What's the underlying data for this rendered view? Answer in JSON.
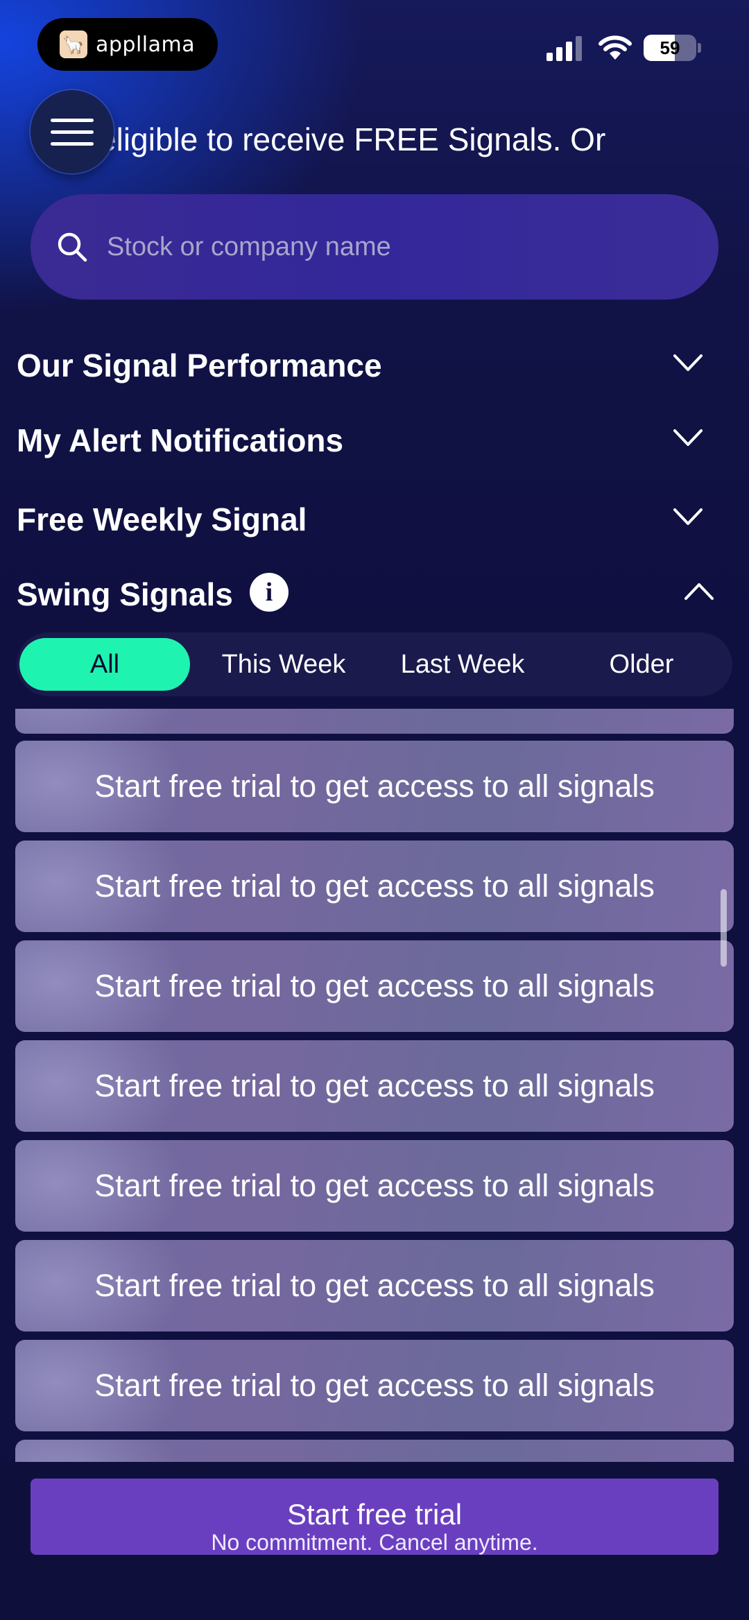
{
  "status_bar": {
    "app_name": "appllama",
    "battery_level": 59,
    "battery_text": "59"
  },
  "header": {
    "ticker_text": "You're eligible to receive FREE Signals. Or"
  },
  "search": {
    "placeholder": "Stock or company name"
  },
  "sections": [
    {
      "title": "Our Signal Performance",
      "state": "collapsed"
    },
    {
      "title": "My Alert Notifications",
      "state": "collapsed"
    },
    {
      "title": "Free Weekly Signal",
      "state": "collapsed"
    },
    {
      "title": "Swing Signals",
      "state": "expanded"
    }
  ],
  "tabs": [
    {
      "label": "All",
      "active": true
    },
    {
      "label": "This Week",
      "active": false
    },
    {
      "label": "Last Week",
      "active": false
    },
    {
      "label": "Older",
      "active": false
    }
  ],
  "cards": [
    "",
    "Start free trial to get access to all signals",
    "Start free trial to get access to all signals",
    "Start free trial to get access to all signals",
    "Start free trial to get access to all signals",
    "Start free trial to get access to all signals",
    "Start free trial to get access to all signals",
    "Start free trial to get access to all signals",
    ""
  ],
  "cta": {
    "label": "Start free trial",
    "sub_label": "No commitment. Cancel anytime."
  },
  "colors": {
    "accent_tab": "#1ff3b0",
    "cta": "#6a3fbf",
    "search": "#33279a"
  }
}
